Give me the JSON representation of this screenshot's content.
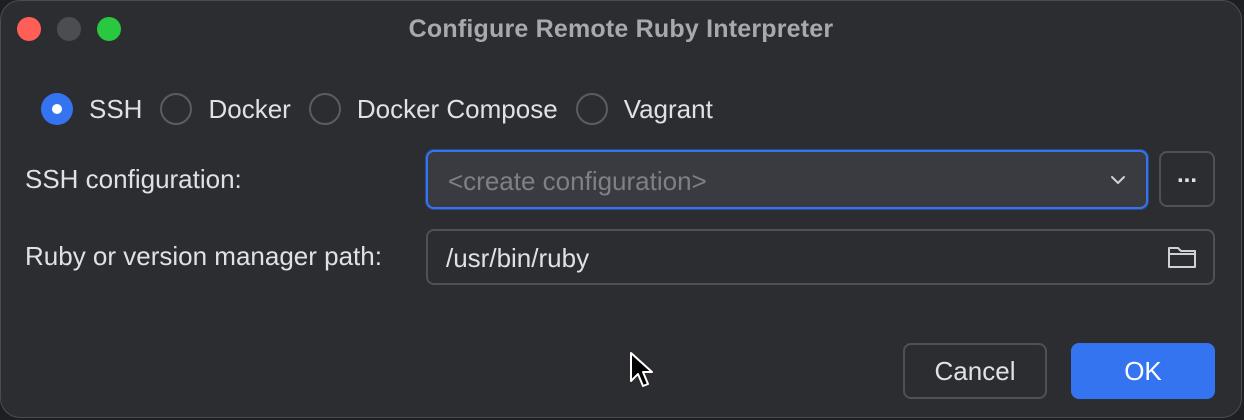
{
  "window": {
    "title": "Configure Remote Ruby Interpreter"
  },
  "radio_group": {
    "options": [
      {
        "label": "SSH",
        "checked": true
      },
      {
        "label": "Docker",
        "checked": false
      },
      {
        "label": "Docker Compose",
        "checked": false
      },
      {
        "label": "Vagrant",
        "checked": false
      }
    ]
  },
  "ssh_config": {
    "label": "SSH configuration:",
    "placeholder": "<create configuration>",
    "browse_label": "..."
  },
  "ruby_path": {
    "label": "Ruby or version manager path:",
    "value": "/usr/bin/ruby"
  },
  "buttons": {
    "cancel": "Cancel",
    "ok": "OK"
  },
  "colors": {
    "accent": "#3574f0",
    "background": "#2b2d30",
    "text": "#dfe1e5",
    "close": "#ff5f57",
    "maximize": "#28c840"
  }
}
